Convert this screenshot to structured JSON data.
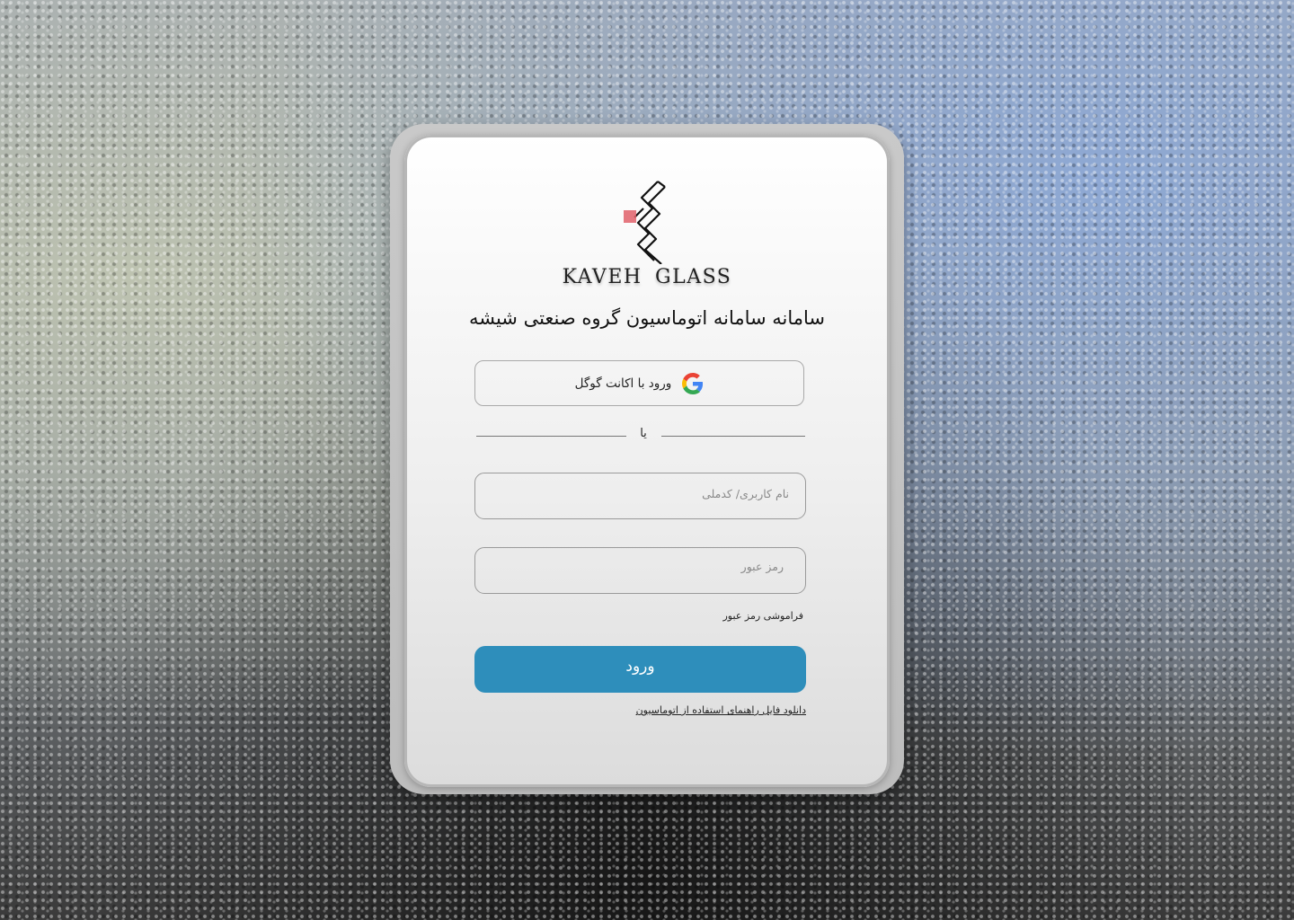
{
  "brand": {
    "logo_icon": "kaveh-glass-logo-icon",
    "name": "KAVEH GLASS"
  },
  "title": "سامانه سامانه اتوماسیون گروه صنعتی شیشه",
  "google_login": {
    "label": "ورود با اکانت گوگل",
    "icon": "google-icon"
  },
  "divider": {
    "text": "یا"
  },
  "form": {
    "username_placeholder": "نام کاربری/ کدملی",
    "username_value": "",
    "password_placeholder": "رمز عبور",
    "password_value": "",
    "forgot_password": "فراموشی رمز عبور",
    "submit_label": "ورود",
    "guide_link": "دانلود فایل راهنمای استفاده از اتوماسیون"
  },
  "colors": {
    "primary_button": "#2e8ebb",
    "logo_accent": "#e0606a"
  }
}
